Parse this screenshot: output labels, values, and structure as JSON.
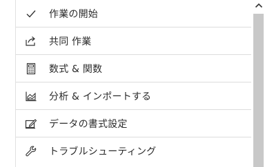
{
  "menu": {
    "items": [
      {
        "label": "作業の開始",
        "icon": "checkmark-icon"
      },
      {
        "label": "共同 作業",
        "icon": "share-icon"
      },
      {
        "label": "数式 & 関数",
        "icon": "calculator-icon"
      },
      {
        "label": "分析 & インポートする",
        "icon": "chart-icon"
      },
      {
        "label": "データの書式設定",
        "icon": "format-icon"
      },
      {
        "label": "トラブルシューティング",
        "icon": "wrench-icon"
      }
    ]
  },
  "colors": {
    "text": "#2b2b2b",
    "divider": "#dcdcdc",
    "scrollbar_thumb": "#c8c8c8"
  }
}
